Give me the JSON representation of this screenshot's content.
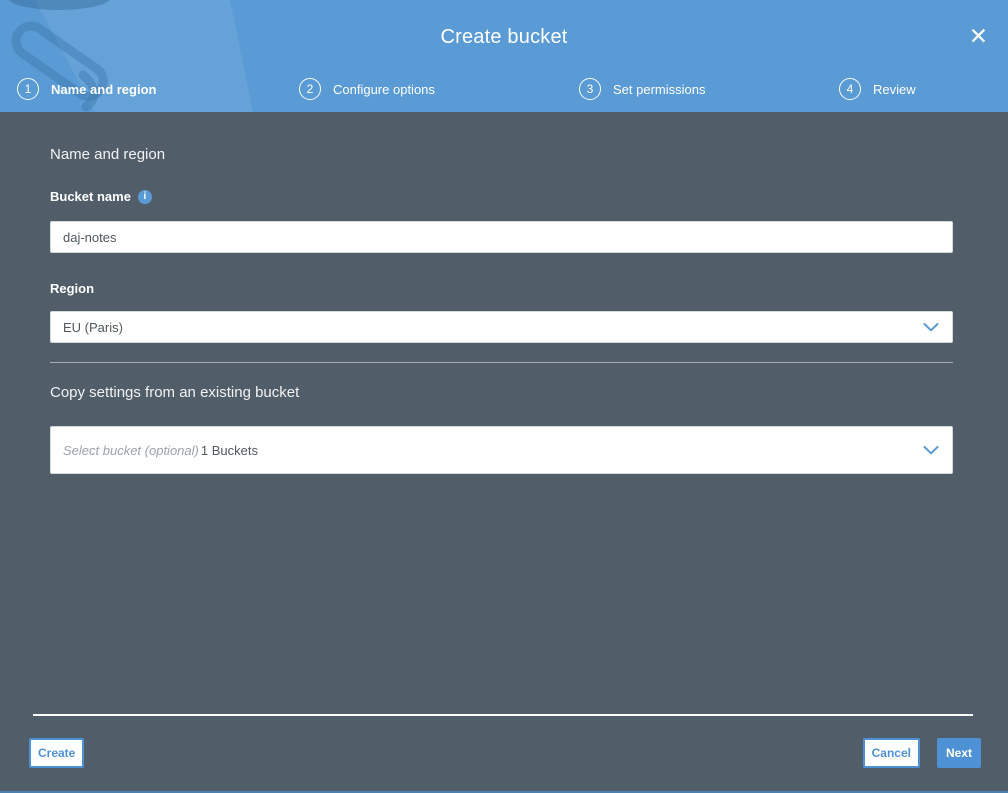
{
  "header": {
    "title": "Create bucket",
    "close_glyph": "✕"
  },
  "stepper": {
    "active_step": "1",
    "steps": [
      {
        "number": "1",
        "label": "Name and region"
      },
      {
        "number": "2",
        "label": "Configure options"
      },
      {
        "number": "3",
        "label": "Set permissions"
      },
      {
        "number": "4",
        "label": "Review"
      }
    ]
  },
  "form": {
    "section_heading": "Name and region",
    "bucket_name_label": "Bucket name",
    "bucket_name_value": "daj-notes",
    "region_label": "Region",
    "region_value": "EU (Paris)",
    "copy_heading": "Copy settings from an existing bucket",
    "bucket_select_placeholder": "Select bucket (optional)",
    "bucket_select_count": "1 Buckets"
  },
  "footer": {
    "create_label": "Create",
    "cancel_label": "Cancel",
    "next_label": "Next"
  },
  "icons": {
    "info_glyph": "i"
  },
  "colors": {
    "header_blue": "#5A9BD5",
    "body_slate": "#515D69",
    "accent_blue": "#4E92D5"
  }
}
